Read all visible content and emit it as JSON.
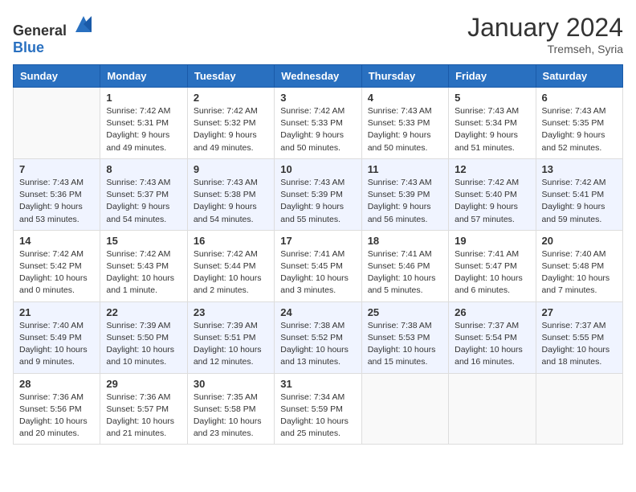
{
  "header": {
    "logo_general": "General",
    "logo_blue": "Blue",
    "month_year": "January 2024",
    "location": "Tremseh, Syria"
  },
  "weekdays": [
    "Sunday",
    "Monday",
    "Tuesday",
    "Wednesday",
    "Thursday",
    "Friday",
    "Saturday"
  ],
  "weeks": [
    [
      {
        "day": "",
        "sunrise": "",
        "sunset": "",
        "daylight": ""
      },
      {
        "day": "1",
        "sunrise": "Sunrise: 7:42 AM",
        "sunset": "Sunset: 5:31 PM",
        "daylight": "Daylight: 9 hours and 49 minutes."
      },
      {
        "day": "2",
        "sunrise": "Sunrise: 7:42 AM",
        "sunset": "Sunset: 5:32 PM",
        "daylight": "Daylight: 9 hours and 49 minutes."
      },
      {
        "day": "3",
        "sunrise": "Sunrise: 7:42 AM",
        "sunset": "Sunset: 5:33 PM",
        "daylight": "Daylight: 9 hours and 50 minutes."
      },
      {
        "day": "4",
        "sunrise": "Sunrise: 7:43 AM",
        "sunset": "Sunset: 5:33 PM",
        "daylight": "Daylight: 9 hours and 50 minutes."
      },
      {
        "day": "5",
        "sunrise": "Sunrise: 7:43 AM",
        "sunset": "Sunset: 5:34 PM",
        "daylight": "Daylight: 9 hours and 51 minutes."
      },
      {
        "day": "6",
        "sunrise": "Sunrise: 7:43 AM",
        "sunset": "Sunset: 5:35 PM",
        "daylight": "Daylight: 9 hours and 52 minutes."
      }
    ],
    [
      {
        "day": "7",
        "sunrise": "Sunrise: 7:43 AM",
        "sunset": "Sunset: 5:36 PM",
        "daylight": "Daylight: 9 hours and 53 minutes."
      },
      {
        "day": "8",
        "sunrise": "Sunrise: 7:43 AM",
        "sunset": "Sunset: 5:37 PM",
        "daylight": "Daylight: 9 hours and 54 minutes."
      },
      {
        "day": "9",
        "sunrise": "Sunrise: 7:43 AM",
        "sunset": "Sunset: 5:38 PM",
        "daylight": "Daylight: 9 hours and 54 minutes."
      },
      {
        "day": "10",
        "sunrise": "Sunrise: 7:43 AM",
        "sunset": "Sunset: 5:39 PM",
        "daylight": "Daylight: 9 hours and 55 minutes."
      },
      {
        "day": "11",
        "sunrise": "Sunrise: 7:43 AM",
        "sunset": "Sunset: 5:39 PM",
        "daylight": "Daylight: 9 hours and 56 minutes."
      },
      {
        "day": "12",
        "sunrise": "Sunrise: 7:42 AM",
        "sunset": "Sunset: 5:40 PM",
        "daylight": "Daylight: 9 hours and 57 minutes."
      },
      {
        "day": "13",
        "sunrise": "Sunrise: 7:42 AM",
        "sunset": "Sunset: 5:41 PM",
        "daylight": "Daylight: 9 hours and 59 minutes."
      }
    ],
    [
      {
        "day": "14",
        "sunrise": "Sunrise: 7:42 AM",
        "sunset": "Sunset: 5:42 PM",
        "daylight": "Daylight: 10 hours and 0 minutes."
      },
      {
        "day": "15",
        "sunrise": "Sunrise: 7:42 AM",
        "sunset": "Sunset: 5:43 PM",
        "daylight": "Daylight: 10 hours and 1 minute."
      },
      {
        "day": "16",
        "sunrise": "Sunrise: 7:42 AM",
        "sunset": "Sunset: 5:44 PM",
        "daylight": "Daylight: 10 hours and 2 minutes."
      },
      {
        "day": "17",
        "sunrise": "Sunrise: 7:41 AM",
        "sunset": "Sunset: 5:45 PM",
        "daylight": "Daylight: 10 hours and 3 minutes."
      },
      {
        "day": "18",
        "sunrise": "Sunrise: 7:41 AM",
        "sunset": "Sunset: 5:46 PM",
        "daylight": "Daylight: 10 hours and 5 minutes."
      },
      {
        "day": "19",
        "sunrise": "Sunrise: 7:41 AM",
        "sunset": "Sunset: 5:47 PM",
        "daylight": "Daylight: 10 hours and 6 minutes."
      },
      {
        "day": "20",
        "sunrise": "Sunrise: 7:40 AM",
        "sunset": "Sunset: 5:48 PM",
        "daylight": "Daylight: 10 hours and 7 minutes."
      }
    ],
    [
      {
        "day": "21",
        "sunrise": "Sunrise: 7:40 AM",
        "sunset": "Sunset: 5:49 PM",
        "daylight": "Daylight: 10 hours and 9 minutes."
      },
      {
        "day": "22",
        "sunrise": "Sunrise: 7:39 AM",
        "sunset": "Sunset: 5:50 PM",
        "daylight": "Daylight: 10 hours and 10 minutes."
      },
      {
        "day": "23",
        "sunrise": "Sunrise: 7:39 AM",
        "sunset": "Sunset: 5:51 PM",
        "daylight": "Daylight: 10 hours and 12 minutes."
      },
      {
        "day": "24",
        "sunrise": "Sunrise: 7:38 AM",
        "sunset": "Sunset: 5:52 PM",
        "daylight": "Daylight: 10 hours and 13 minutes."
      },
      {
        "day": "25",
        "sunrise": "Sunrise: 7:38 AM",
        "sunset": "Sunset: 5:53 PM",
        "daylight": "Daylight: 10 hours and 15 minutes."
      },
      {
        "day": "26",
        "sunrise": "Sunrise: 7:37 AM",
        "sunset": "Sunset: 5:54 PM",
        "daylight": "Daylight: 10 hours and 16 minutes."
      },
      {
        "day": "27",
        "sunrise": "Sunrise: 7:37 AM",
        "sunset": "Sunset: 5:55 PM",
        "daylight": "Daylight: 10 hours and 18 minutes."
      }
    ],
    [
      {
        "day": "28",
        "sunrise": "Sunrise: 7:36 AM",
        "sunset": "Sunset: 5:56 PM",
        "daylight": "Daylight: 10 hours and 20 minutes."
      },
      {
        "day": "29",
        "sunrise": "Sunrise: 7:36 AM",
        "sunset": "Sunset: 5:57 PM",
        "daylight": "Daylight: 10 hours and 21 minutes."
      },
      {
        "day": "30",
        "sunrise": "Sunrise: 7:35 AM",
        "sunset": "Sunset: 5:58 PM",
        "daylight": "Daylight: 10 hours and 23 minutes."
      },
      {
        "day": "31",
        "sunrise": "Sunrise: 7:34 AM",
        "sunset": "Sunset: 5:59 PM",
        "daylight": "Daylight: 10 hours and 25 minutes."
      },
      {
        "day": "",
        "sunrise": "",
        "sunset": "",
        "daylight": ""
      },
      {
        "day": "",
        "sunrise": "",
        "sunset": "",
        "daylight": ""
      },
      {
        "day": "",
        "sunrise": "",
        "sunset": "",
        "daylight": ""
      }
    ]
  ]
}
